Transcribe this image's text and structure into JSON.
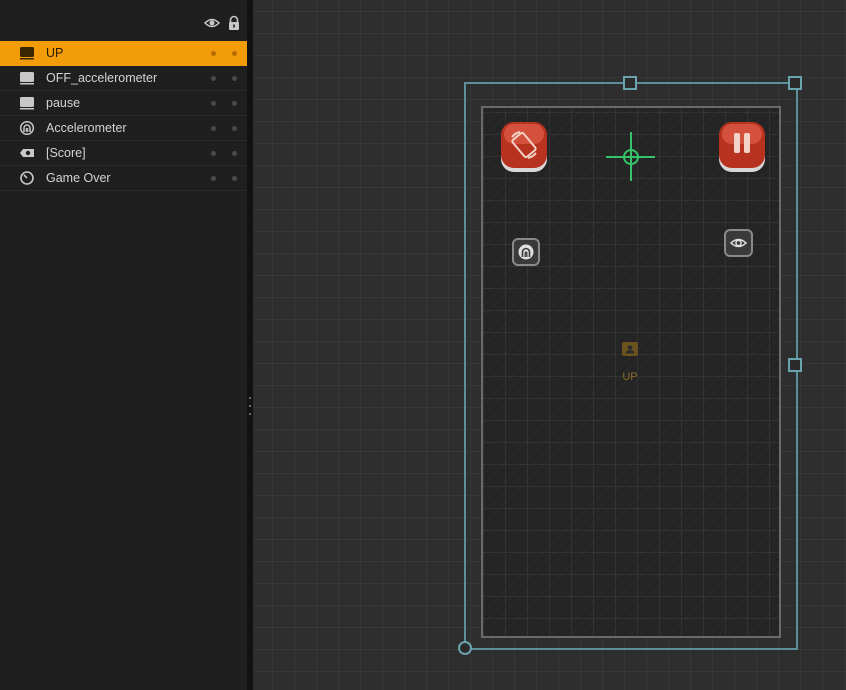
{
  "panel": {
    "header_icons": [
      "eye-icon",
      "lock-icon"
    ],
    "layers": [
      {
        "label": "UP",
        "icon": "sprite-icon",
        "selected": true
      },
      {
        "label": "OFF_accelerometer",
        "icon": "sprite-icon",
        "selected": false
      },
      {
        "label": "pause",
        "icon": "sprite-icon",
        "selected": false
      },
      {
        "label": "Accelerometer",
        "icon": "accelerometer-icon",
        "selected": false
      },
      {
        "label": "[Score]",
        "icon": "score-eye-icon",
        "selected": false
      },
      {
        "label": "Game Over",
        "icon": "timer-icon",
        "selected": false
      }
    ]
  },
  "canvas": {
    "up_marker_label": "UP",
    "objects": [
      "rotate-button",
      "crosshair",
      "pause-button",
      "accelerometer-object",
      "score-object",
      "up-marker"
    ]
  },
  "colors": {
    "selection_accent": "#f39c0a",
    "frame_outline": "#5b8f99",
    "crosshair": "#35c46a",
    "button_red": "#c8402a"
  }
}
